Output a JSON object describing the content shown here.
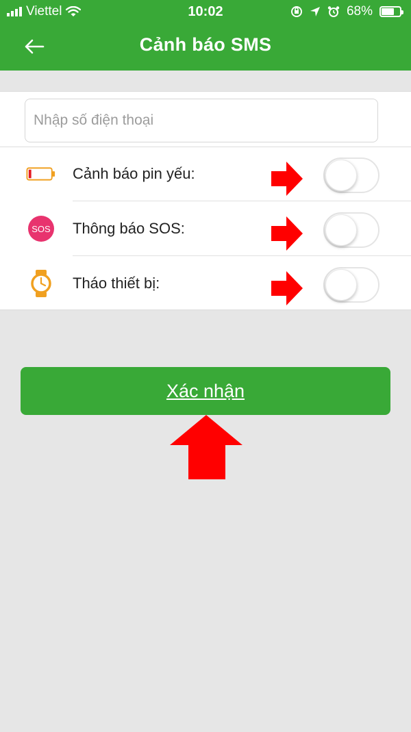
{
  "status_bar": {
    "carrier": "Viettel",
    "time": "10:02",
    "battery": "68%",
    "battery_level": 0.68,
    "icons": [
      "signal-icon",
      "wifi-icon",
      "rotation-lock-icon",
      "location-icon",
      "alarm-icon",
      "battery-icon"
    ]
  },
  "header": {
    "title": "Cảnh báo SMS",
    "back_icon": "back-arrow-icon",
    "color": "#39a937"
  },
  "form": {
    "phone_placeholder": "Nhập số điện thoại",
    "phone_value": ""
  },
  "settings": [
    {
      "label": "Cảnh báo pin yếu:",
      "icon": "low-battery-icon",
      "enabled": false
    },
    {
      "label": "Thông báo SOS:",
      "icon": "sos-icon",
      "icon_text": "SOS",
      "enabled": false
    },
    {
      "label": "Tháo thiết bị:",
      "icon": "watch-icon",
      "enabled": false
    }
  ],
  "confirm_button": {
    "label": "Xác nhận"
  },
  "colors": {
    "accent_green": "#39a937",
    "background": "#e6e6e6",
    "sos_pink": "#e8336e",
    "watch_orange": "#f0a020",
    "annotation_red": "#ff0000"
  }
}
